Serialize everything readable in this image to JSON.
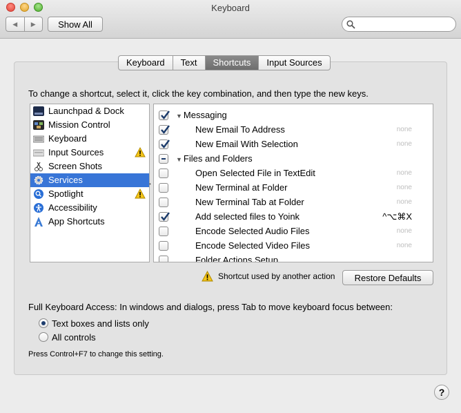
{
  "window": {
    "title": "Keyboard",
    "show_all": "Show All",
    "search_placeholder": ""
  },
  "tabs": [
    {
      "label": "Keyboard",
      "active": false
    },
    {
      "label": "Text",
      "active": false
    },
    {
      "label": "Shortcuts",
      "active": true
    },
    {
      "label": "Input Sources",
      "active": false
    }
  ],
  "instruction": "To change a shortcut, select it, click the key combination, and then type the new keys.",
  "categories": [
    {
      "label": "Launchpad & Dock",
      "icon": "launchpad-icon",
      "warning": false,
      "selected": false
    },
    {
      "label": "Mission Control",
      "icon": "mission-control-icon",
      "warning": false,
      "selected": false
    },
    {
      "label": "Keyboard",
      "icon": "keyboard-icon",
      "warning": false,
      "selected": false
    },
    {
      "label": "Input Sources",
      "icon": "input-sources-icon",
      "warning": true,
      "selected": false
    },
    {
      "label": "Screen Shots",
      "icon": "screenshot-icon",
      "warning": false,
      "selected": false
    },
    {
      "label": "Services",
      "icon": "services-gear-icon",
      "warning": false,
      "selected": true
    },
    {
      "label": "Spotlight",
      "icon": "spotlight-icon",
      "warning": true,
      "selected": false
    },
    {
      "label": "Accessibility",
      "icon": "accessibility-icon",
      "warning": false,
      "selected": false
    },
    {
      "label": "App Shortcuts",
      "icon": "app-shortcuts-icon",
      "warning": false,
      "selected": false
    }
  ],
  "shortcuts": [
    {
      "type": "group",
      "label": "Messaging",
      "state": "checked"
    },
    {
      "type": "item",
      "label": "New Email To Address",
      "state": "checked",
      "key": "none"
    },
    {
      "type": "item",
      "label": "New Email With Selection",
      "state": "checked",
      "key": "none"
    },
    {
      "type": "group",
      "label": "Files and Folders",
      "state": "mixed"
    },
    {
      "type": "item",
      "label": "Open Selected File in TextEdit",
      "state": "unchecked",
      "key": "none"
    },
    {
      "type": "item",
      "label": "New Terminal at Folder",
      "state": "unchecked",
      "key": "none"
    },
    {
      "type": "item",
      "label": "New Terminal Tab at Folder",
      "state": "unchecked",
      "key": "none"
    },
    {
      "type": "item",
      "label": "Add selected files to Yoink",
      "state": "checked",
      "key": "^⌥⌘X"
    },
    {
      "type": "item",
      "label": "Encode Selected Audio Files",
      "state": "unchecked",
      "key": "none"
    },
    {
      "type": "item",
      "label": "Encode Selected Video Files",
      "state": "unchecked",
      "key": "none"
    },
    {
      "type": "item",
      "label": "Folder Actions Setup...",
      "state": "unchecked",
      "key": ""
    }
  ],
  "legend_text": "Shortcut used by another action",
  "restore_button": "Restore Defaults",
  "full_keyboard_access": "Full Keyboard Access: In windows and dialogs, press Tab to move keyboard focus between:",
  "radio_options": [
    {
      "label": "Text boxes and lists only",
      "selected": true
    },
    {
      "label": "All controls",
      "selected": false
    }
  ],
  "hint": "Press Control+F7 to change this setting.",
  "help": "?",
  "colors": {
    "selection": "#3875d7",
    "warning": "#f5c518"
  }
}
